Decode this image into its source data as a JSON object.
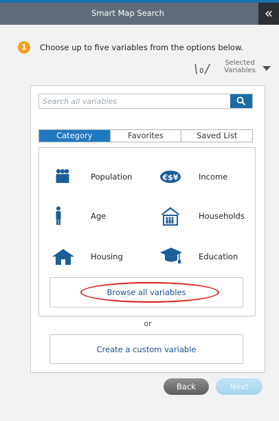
{
  "header": {
    "title": "Smart Map Search",
    "collapse_icon": "«"
  },
  "step": {
    "number": "1",
    "text": "Choose up to five variables from the options below."
  },
  "selected": {
    "count": "0",
    "label_line1": "Selected",
    "label_line2": "Variables"
  },
  "search": {
    "placeholder": "Search all variables"
  },
  "tabs": [
    {
      "label": "Category",
      "active": true
    },
    {
      "label": "Favorites",
      "active": false
    },
    {
      "label": "Saved List",
      "active": false
    }
  ],
  "categories": [
    {
      "label": "Population",
      "icon": "population-icon"
    },
    {
      "label": "Income",
      "icon": "income-icon"
    },
    {
      "label": "Age",
      "icon": "age-icon"
    },
    {
      "label": "Households",
      "icon": "households-icon"
    },
    {
      "label": "Housing",
      "icon": "housing-icon"
    },
    {
      "label": "Education",
      "icon": "education-icon"
    }
  ],
  "browse_label": "Browse all variables",
  "or_text": "or",
  "custom_label": "Create a custom variable",
  "buttons": {
    "back": "Back",
    "next": "Next"
  },
  "colors": {
    "accent": "#1c6ba5",
    "step_badge": "#f0a020",
    "highlight_oval": "#d81d1d",
    "header": "#5f6b78"
  }
}
